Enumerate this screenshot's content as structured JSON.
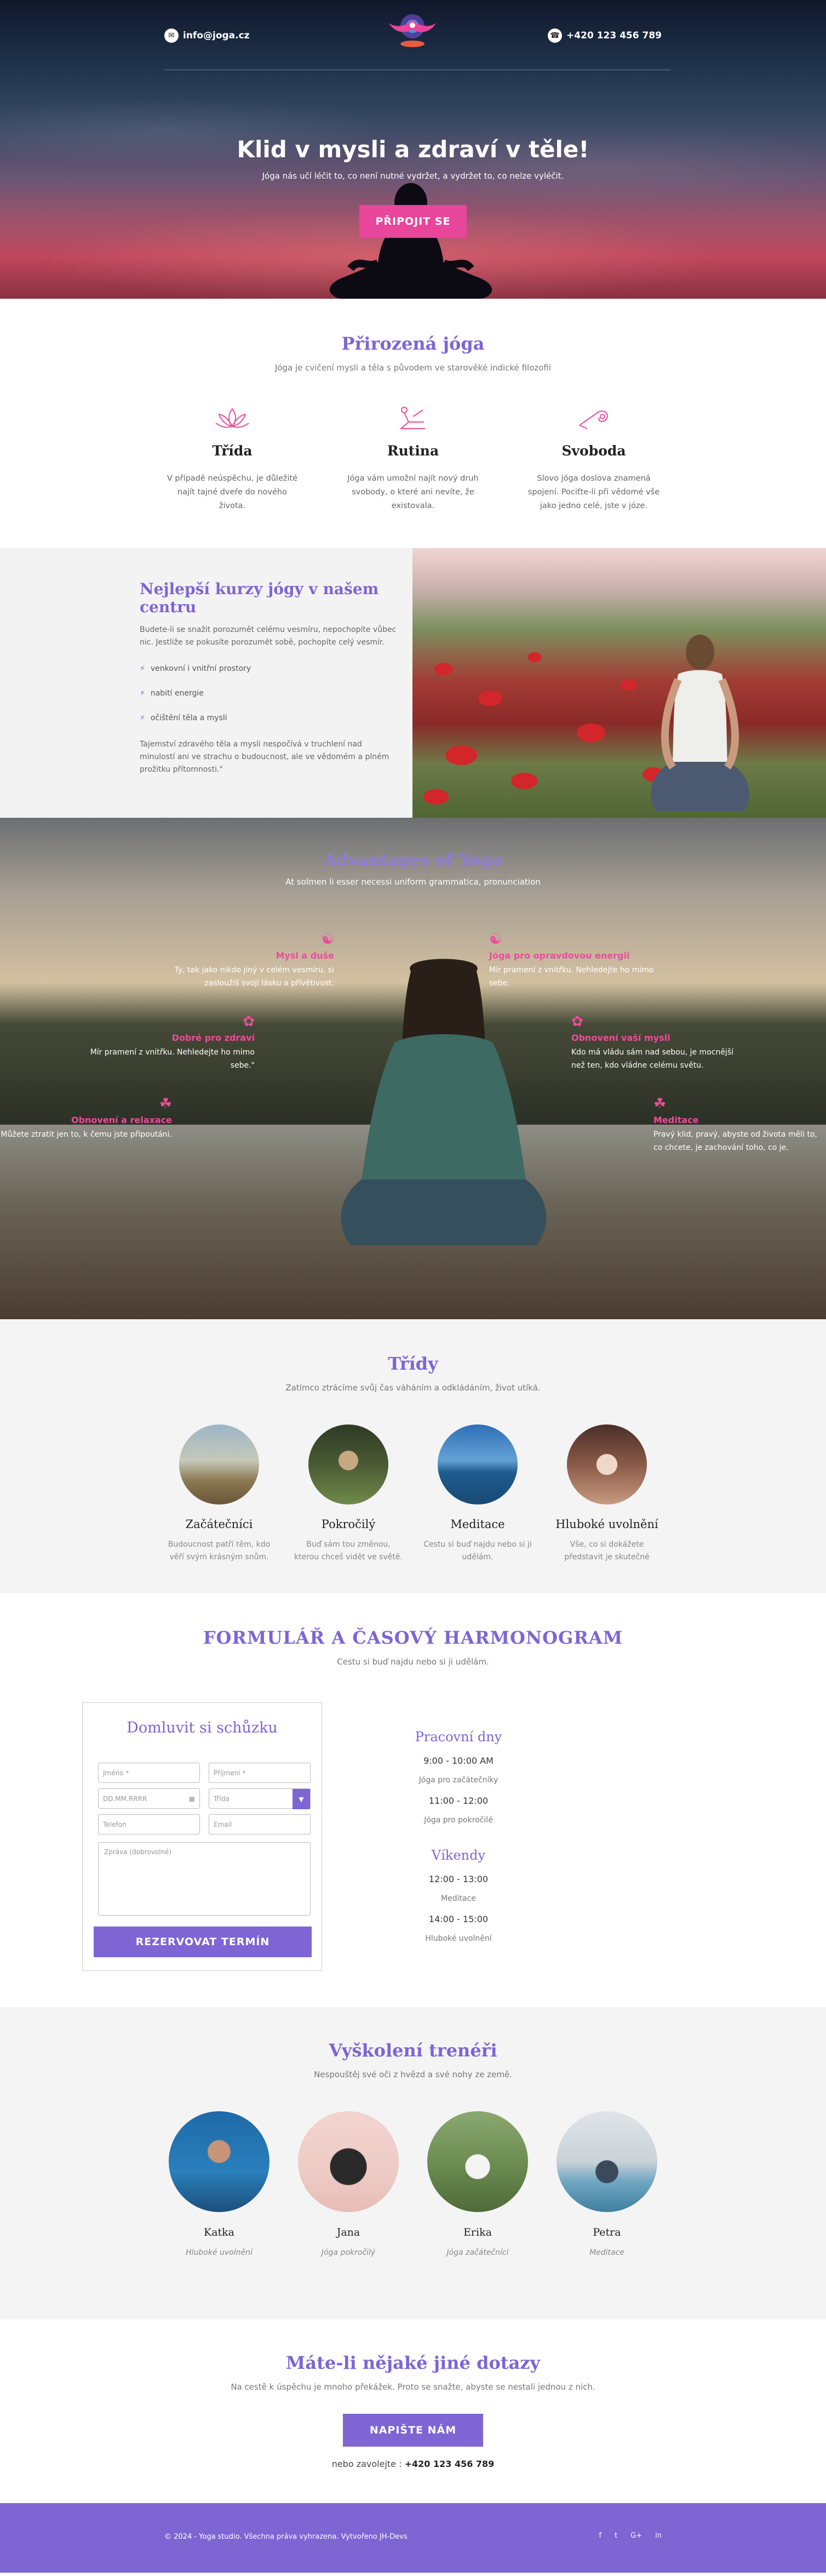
{
  "header": {
    "email": "info@joga.cz",
    "phone": "+420 123 456 789",
    "title": "Klid v mysli a zdraví v těle!",
    "subtitle": "Jóga nás učí léčit to, co není nutné vydržet, a vydržet to, co nelze vyléčit.",
    "cta": "PŘIPOJIT SE"
  },
  "natural": {
    "title": "Přirozená jóga",
    "subtitle": "Jóga je cvičení mysli a těla s původem ve starověké indické filozofii",
    "features": [
      {
        "icon": "lotus-icon",
        "title": "Třída",
        "text": "V případě neúspěchu, je důležité najít tajné dveře do nového života."
      },
      {
        "icon": "yoga-pose-icon",
        "title": "Rutina",
        "text": "Jóga vám umožní najít nový druh svobody, o které ani nevíte, že existovala."
      },
      {
        "icon": "mat-icon",
        "title": "Svoboda",
        "text": "Slovo jóga doslova znamená spojení. Pociťte-li při vědomé vše jako jedno celé, jste v józe."
      }
    ]
  },
  "courses": {
    "title": "Nejlepší kurzy jógy v našem centru",
    "intro": "Budete-li se snažit porozumět celému vesmíru, nepochopíte vůbec nic. Jestliže se pokusíte porozumět sobě, pochopíte celý vesmír.",
    "items": [
      "venkovní i vnitřní prostory",
      "nabití energie",
      "očištění těla a mysli"
    ],
    "outro": "Tajemství zdravého těla a mysli nespočívá v truchlení nad minulostí ani ve strachu o budoucnost, ale ve vědomém a plném prožitku přítomnosti.\""
  },
  "advantages": {
    "title": "Advantages of Yoga",
    "subtitle": "At solmen li esser necessi uniform grammatica, pronunciation",
    "items": [
      {
        "title": "Mysl a duše",
        "text": "Ty, tak jako nikdo jiný v celém vesmíru, si zasloužíš svoji lásku a přívětivost."
      },
      {
        "title": "Jóga pro opravdovou energii",
        "text": "Mír pramení z vnitřku. Nehledejte ho mimo sebe."
      },
      {
        "title": "Dobré pro zdraví",
        "text": "Mír pramení z vnitřku. Nehledejte ho mimo sebe.\""
      },
      {
        "title": "Obnovení vaší mysli",
        "text": "Kdo má vládu sám nad sebou, je mocnější než ten, kdo vládne celému světu."
      },
      {
        "title": "Obnovení a relaxace",
        "text": "Můžete ztratit jen to, k čemu jste připoutáni."
      },
      {
        "title": "Meditace",
        "text": "Pravý klid, pravý, abyste od života měli to, co chcete, je zachování toho, co je."
      }
    ]
  },
  "classes": {
    "title": "Třídy",
    "subtitle": "Zatímco ztrácíme svůj čas váháním a odkládáním, život utíká.",
    "items": [
      {
        "title": "Začátečníci",
        "text": "Budoucnost patří těm, kdo věří svým krásným snům."
      },
      {
        "title": "Pokročilý",
        "text": "Buď sám tou změnou, kterou chceš vidět ve světě."
      },
      {
        "title": "Meditace",
        "text": "Cestu si buď najdu nebo si ji udělám."
      },
      {
        "title": "Hluboké uvolnění",
        "text": "Vše, co si dokážete představit je skutečné"
      }
    ]
  },
  "form": {
    "title": "FORMULÁŘ A ČASOVÝ HARMONOGRAM",
    "subtitle": "Cestu si buď najdu nebo si ji udělám.",
    "card_title": "Domluvit si schůzku",
    "first_name": "Jméno *",
    "last_name": "Příjmení *",
    "date": "DD.MM.RRRR",
    "class_select": "Třída",
    "phone": "Telefon",
    "email": "Email",
    "message": "Zpráva (dobrovolné)",
    "submit": "REZERVOVAT TERMÍN"
  },
  "schedule": {
    "weekdays_title": "Pracovní dny",
    "weekdays": [
      {
        "time": "9:00 - 10:00 AM",
        "label": "Jóga pro začátečníky"
      },
      {
        "time": "11:00 - 12:00",
        "label": "Jóga pro pokročilé"
      }
    ],
    "weekend_title": "Víkendy",
    "weekend": [
      {
        "time": "12:00 - 13:00",
        "label": "Meditace"
      },
      {
        "time": "14:00 - 15:00",
        "label": "Hluboké uvolnění"
      }
    ]
  },
  "trainers": {
    "title": "Vyškolení trenéři",
    "subtitle": "Nespouštěj své oči z hvězd a své nohy ze země.",
    "items": [
      {
        "name": "Katka",
        "role": "Hluboké uvolnění"
      },
      {
        "name": "Jana",
        "role": "Jóga pokročilý"
      },
      {
        "name": "Erika",
        "role": "Jóga začátečníci"
      },
      {
        "name": "Petra",
        "role": "Meditace"
      }
    ]
  },
  "contact": {
    "title": "Máte-li nějaké jiné dotazy",
    "subtitle": "Na cestě k úspěchu je mnoho překážek. Proto se snažte, abyste se nestali jednou z nich.",
    "button": "NAPIŠTE NÁM",
    "call_prefix": "nebo zavolejte :",
    "phone": "+420 123 456 789"
  },
  "footer": {
    "copyright": "© 2024 - Yoga studio. Všechna práva vyhrazena. Vytvořeno JH-Devs",
    "social": [
      "f",
      "t",
      "G+",
      "in"
    ]
  },
  "colors": {
    "accent": "#7d65d4",
    "pink": "#e8469a"
  }
}
